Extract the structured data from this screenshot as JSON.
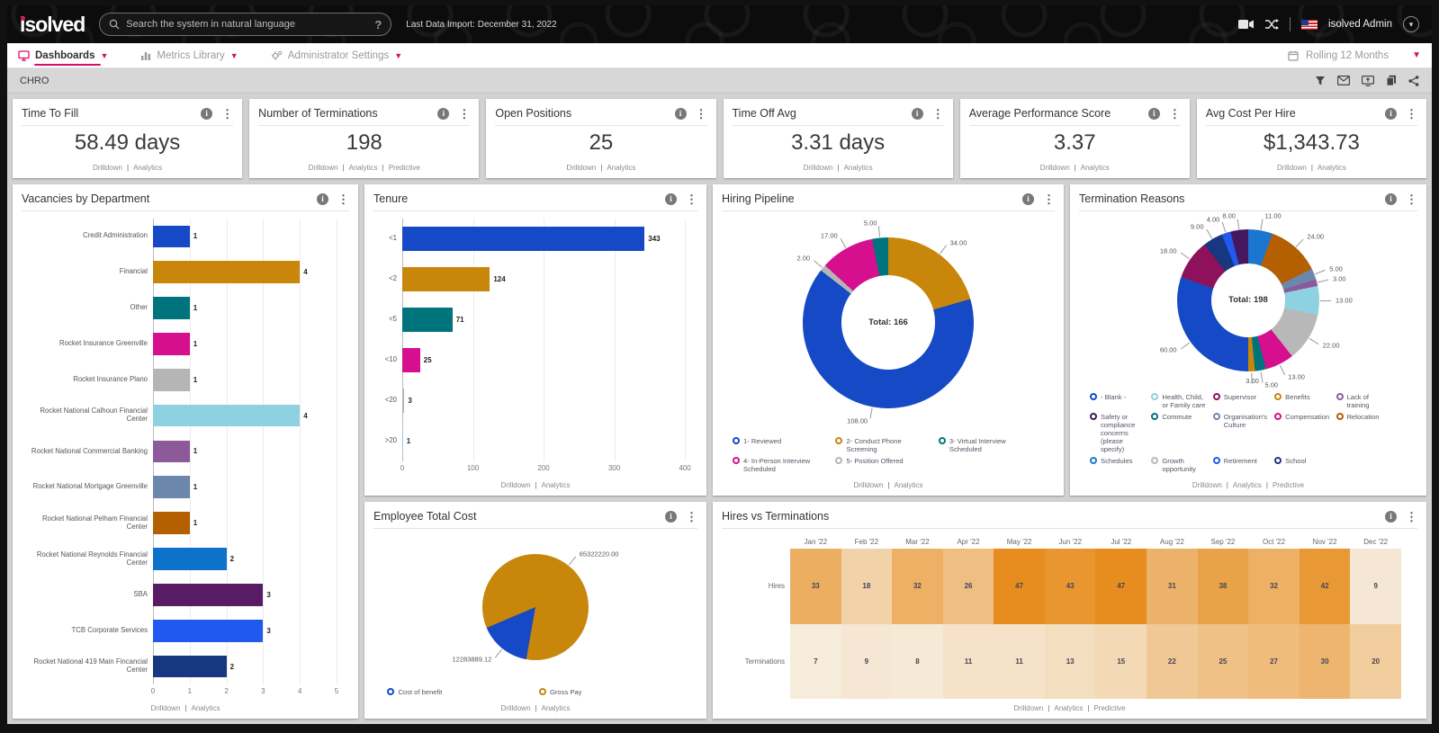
{
  "topbar": {
    "logo": "isolved",
    "search_placeholder": "Search the system in natural language",
    "help_glyph": "?",
    "last_import": "Last Data Import: December 31, 2022",
    "user": "isolved Admin"
  },
  "nav": {
    "items": [
      {
        "label": "Dashboards",
        "active": true
      },
      {
        "label": "Metrics Library",
        "active": false
      },
      {
        "label": "Administrator Settings",
        "active": false
      }
    ],
    "period": "Rolling 12 Months"
  },
  "breadcrumb": {
    "title": "CHRO"
  },
  "icons": [
    "video-camera",
    "shuffle",
    "us-flag",
    "chevron-down",
    "calendar",
    "filter",
    "email",
    "present-screen",
    "copy",
    "share",
    "info",
    "kebab-menu",
    "search",
    "help"
  ],
  "kpis": [
    {
      "title": "Time To Fill",
      "value": "58.49 days",
      "footer": [
        "Drilldown",
        "Analytics"
      ]
    },
    {
      "title": "Number of Terminations",
      "value": "198",
      "footer": [
        "Drilldown",
        "Analytics",
        "Predictive"
      ]
    },
    {
      "title": "Open Positions",
      "value": "25",
      "footer": [
        "Drilldown",
        "Analytics"
      ]
    },
    {
      "title": "Time Off Avg",
      "value": "3.31 days",
      "footer": [
        "Drilldown",
        "Analytics"
      ]
    },
    {
      "title": "Average Performance Score",
      "value": "3.37",
      "footer": [
        "Drilldown",
        "Analytics"
      ]
    },
    {
      "title": "Avg Cost Per Hire",
      "value": "$1,343.73",
      "footer": [
        "Drilldown",
        "Analytics"
      ]
    }
  ],
  "chart_data": [
    {
      "id": "vacancies",
      "type": "bar",
      "orientation": "horizontal",
      "title": "Vacancies by Department",
      "categories": [
        "Credit Administration",
        "Financial",
        "Other",
        "Rocket Insurance Greenville",
        "Rocket Insurance Plano",
        "Rocket National Calhoun Financial Center",
        "Rocket National Commercial Banking",
        "Rocket National Mortgage Greenville",
        "Rocket National Pelham Financial Center",
        "Rocket National Reynolds Financial Center",
        "SBA",
        "TCB Corporate Services",
        "Rocket National 419 Main Fincancial Center"
      ],
      "values": [
        1,
        4,
        1,
        1,
        1,
        4,
        1,
        1,
        1,
        2,
        3,
        3,
        2
      ],
      "colors": [
        "#1549c6",
        "#c8860b",
        "#00747d",
        "#d60f8e",
        "#b5b5b5",
        "#8ed1e1",
        "#8d5a99",
        "#6b87ac",
        "#b35f02",
        "#0d72c9",
        "#571c63",
        "#2159ee",
        "#173781"
      ],
      "xlim": [
        0,
        5
      ],
      "xticks": [
        0,
        1,
        2,
        3,
        4,
        5
      ],
      "grid": true,
      "footer": [
        "Drilldown",
        "Analytics"
      ]
    },
    {
      "id": "tenure",
      "type": "bar",
      "orientation": "horizontal",
      "title": "Tenure",
      "categories": [
        "<1",
        "<2",
        "<5",
        "<10",
        "<20",
        ">20"
      ],
      "values": [
        343,
        124,
        71,
        25,
        3,
        1
      ],
      "colors": [
        "#1549c6",
        "#c8860b",
        "#00747d",
        "#d60f8e",
        "#b5b5b5",
        "#8ed1e1"
      ],
      "xlim": [
        0,
        400
      ],
      "xticks": [
        0,
        100,
        200,
        300,
        400
      ],
      "grid": true,
      "footer": [
        "Drilldown",
        "Analytics"
      ]
    },
    {
      "id": "hiring_pipeline",
      "type": "donut",
      "title": "Hiring Pipeline",
      "center_label": "Total: 166",
      "slices": [
        {
          "label": "2- Conduct Phone Screening",
          "value": 34,
          "display": "34.00",
          "color": "#c8860b"
        },
        {
          "label": "1- Reviewed",
          "value": 108,
          "display": "108.00",
          "color": "#1549c6"
        },
        {
          "label": "5- Position Offered",
          "value": 2,
          "display": "2.00",
          "color": "#b5b5b5"
        },
        {
          "label": "4- In-Person Interview Scheduled",
          "value": 17,
          "display": "17.00",
          "color": "#d60f8e"
        },
        {
          "label": "3- Virtual Interview Scheduled",
          "value": 5,
          "display": "5.00",
          "color": "#00747d"
        }
      ],
      "legend": [
        {
          "label": "1- Reviewed",
          "color": "#1549c6"
        },
        {
          "label": "2- Conduct Phone Screening",
          "color": "#c8860b"
        },
        {
          "label": "3- Virtual Interview Scheduled",
          "color": "#00747d"
        },
        {
          "label": "4- In-Person Interview Scheduled",
          "color": "#d60f8e"
        },
        {
          "label": "5- Position Offered",
          "color": "#b5b5b5"
        }
      ],
      "legend_cols": 3,
      "footer": [
        "Drilldown",
        "Analytics"
      ]
    },
    {
      "id": "termination_reasons",
      "type": "donut",
      "title": "Termination Reasons",
      "center_label": "Total: 198",
      "slices": [
        {
          "label": "Schedules",
          "value": 11,
          "display": "11.00",
          "color": "#1b76cf"
        },
        {
          "label": "Relocation",
          "value": 24,
          "display": "24.00",
          "color": "#b35f02"
        },
        {
          "label": "Organisation's Culture",
          "value": 5,
          "display": "5.00",
          "color": "#6b87ac"
        },
        {
          "label": "Lack of training",
          "value": 3,
          "display": "3.00",
          "color": "#8d5a99"
        },
        {
          "label": "Health, Child, or Family care",
          "value": 13,
          "display": "13.00",
          "color": "#8ed1e1"
        },
        {
          "label": "Growth opportunity",
          "value": 22,
          "display": "22.00",
          "color": "#b8b8b8"
        },
        {
          "label": "Compensation",
          "value": 13,
          "display": "13.00",
          "color": "#d60f8e"
        },
        {
          "label": "Commute",
          "value": 5,
          "display": "5.00",
          "color": "#00747d"
        },
        {
          "label": "Benefits",
          "value": 3,
          "display": "3.00",
          "color": "#c8860b"
        },
        {
          "label": "- Blank -",
          "value": 60,
          "display": "60.00",
          "color": "#1549c6"
        },
        {
          "label": "Supervisor",
          "value": 18,
          "display": "18.00",
          "color": "#8e115c"
        },
        {
          "label": "School",
          "value": 9,
          "display": "9.00",
          "color": "#173781"
        },
        {
          "label": "Retirement",
          "value": 4,
          "display": "4.00",
          "color": "#2159ee"
        },
        {
          "label": "Safety or compliance concerns (please specify)",
          "value": 8,
          "display": "8.00",
          "color": "#45175e"
        }
      ],
      "legend": [
        {
          "label": "- Blank -",
          "color": "#1549c6"
        },
        {
          "label": "Health, Child, or Family care",
          "color": "#8ed1e1"
        },
        {
          "label": "Supervisor",
          "color": "#8e115c"
        },
        {
          "label": "Benefits",
          "color": "#c8860b"
        },
        {
          "label": "Lack of training",
          "color": "#8d5a99"
        },
        {
          "label": "Safety or compliance concerns (please specify)",
          "color": "#45175e"
        },
        {
          "label": "Commute",
          "color": "#00747d"
        },
        {
          "label": "Organisation's Culture",
          "color": "#6b87ac"
        },
        {
          "label": "Compensation",
          "color": "#d60f8e"
        },
        {
          "label": "Relocation",
          "color": "#b35f02"
        },
        {
          "label": "Schedules",
          "color": "#1b76cf"
        },
        {
          "label": "Growth opportunity",
          "color": "#b8b8b8"
        },
        {
          "label": "Retirement",
          "color": "#2159ee"
        },
        {
          "label": "School",
          "color": "#173781"
        }
      ],
      "legend_cols": 5,
      "footer": [
        "Drilldown",
        "Analytics",
        "Predictive"
      ]
    },
    {
      "id": "employee_total_cost",
      "type": "pie",
      "title": "Employee Total Cost",
      "slices": [
        {
          "label": "Gross Pay",
          "value": 65322220.0,
          "display": "65322220.00",
          "color": "#c8860b"
        },
        {
          "label": "Cost of benefit",
          "value": 12283889.12,
          "display": "12283889.12",
          "color": "#1549c6"
        }
      ],
      "start_angle": 247,
      "legend": [
        {
          "label": "Cost of benefit",
          "color": "#1549c6"
        },
        {
          "label": "Gross Pay",
          "color": "#c8860b"
        }
      ],
      "legend_cols": 2,
      "footer": [
        "Drilldown",
        "Analytics"
      ]
    },
    {
      "id": "hires_terms",
      "type": "heatmap",
      "title": "Hires vs Terminations",
      "columns": [
        "Jan '22",
        "Feb '22",
        "Mar '22",
        "Apr '22",
        "May '22",
        "Jun '22",
        "Jul '22",
        "Aug '22",
        "Sep '22",
        "Oct '22",
        "Nov '22",
        "Dec '22"
      ],
      "rows": [
        {
          "label": "Hires",
          "values": [
            33,
            18,
            32,
            26,
            47,
            43,
            47,
            31,
            38,
            32,
            42,
            9
          ]
        },
        {
          "label": "Terminations",
          "values": [
            7,
            9,
            8,
            11,
            11,
            13,
            15,
            22,
            25,
            27,
            30,
            20
          ]
        }
      ],
      "scale": {
        "min": 7,
        "max": 47,
        "light": "#f6ecdc",
        "dark": "#e78c1e"
      },
      "footer": [
        "Drilldown",
        "Analytics",
        "Predictive"
      ]
    }
  ]
}
